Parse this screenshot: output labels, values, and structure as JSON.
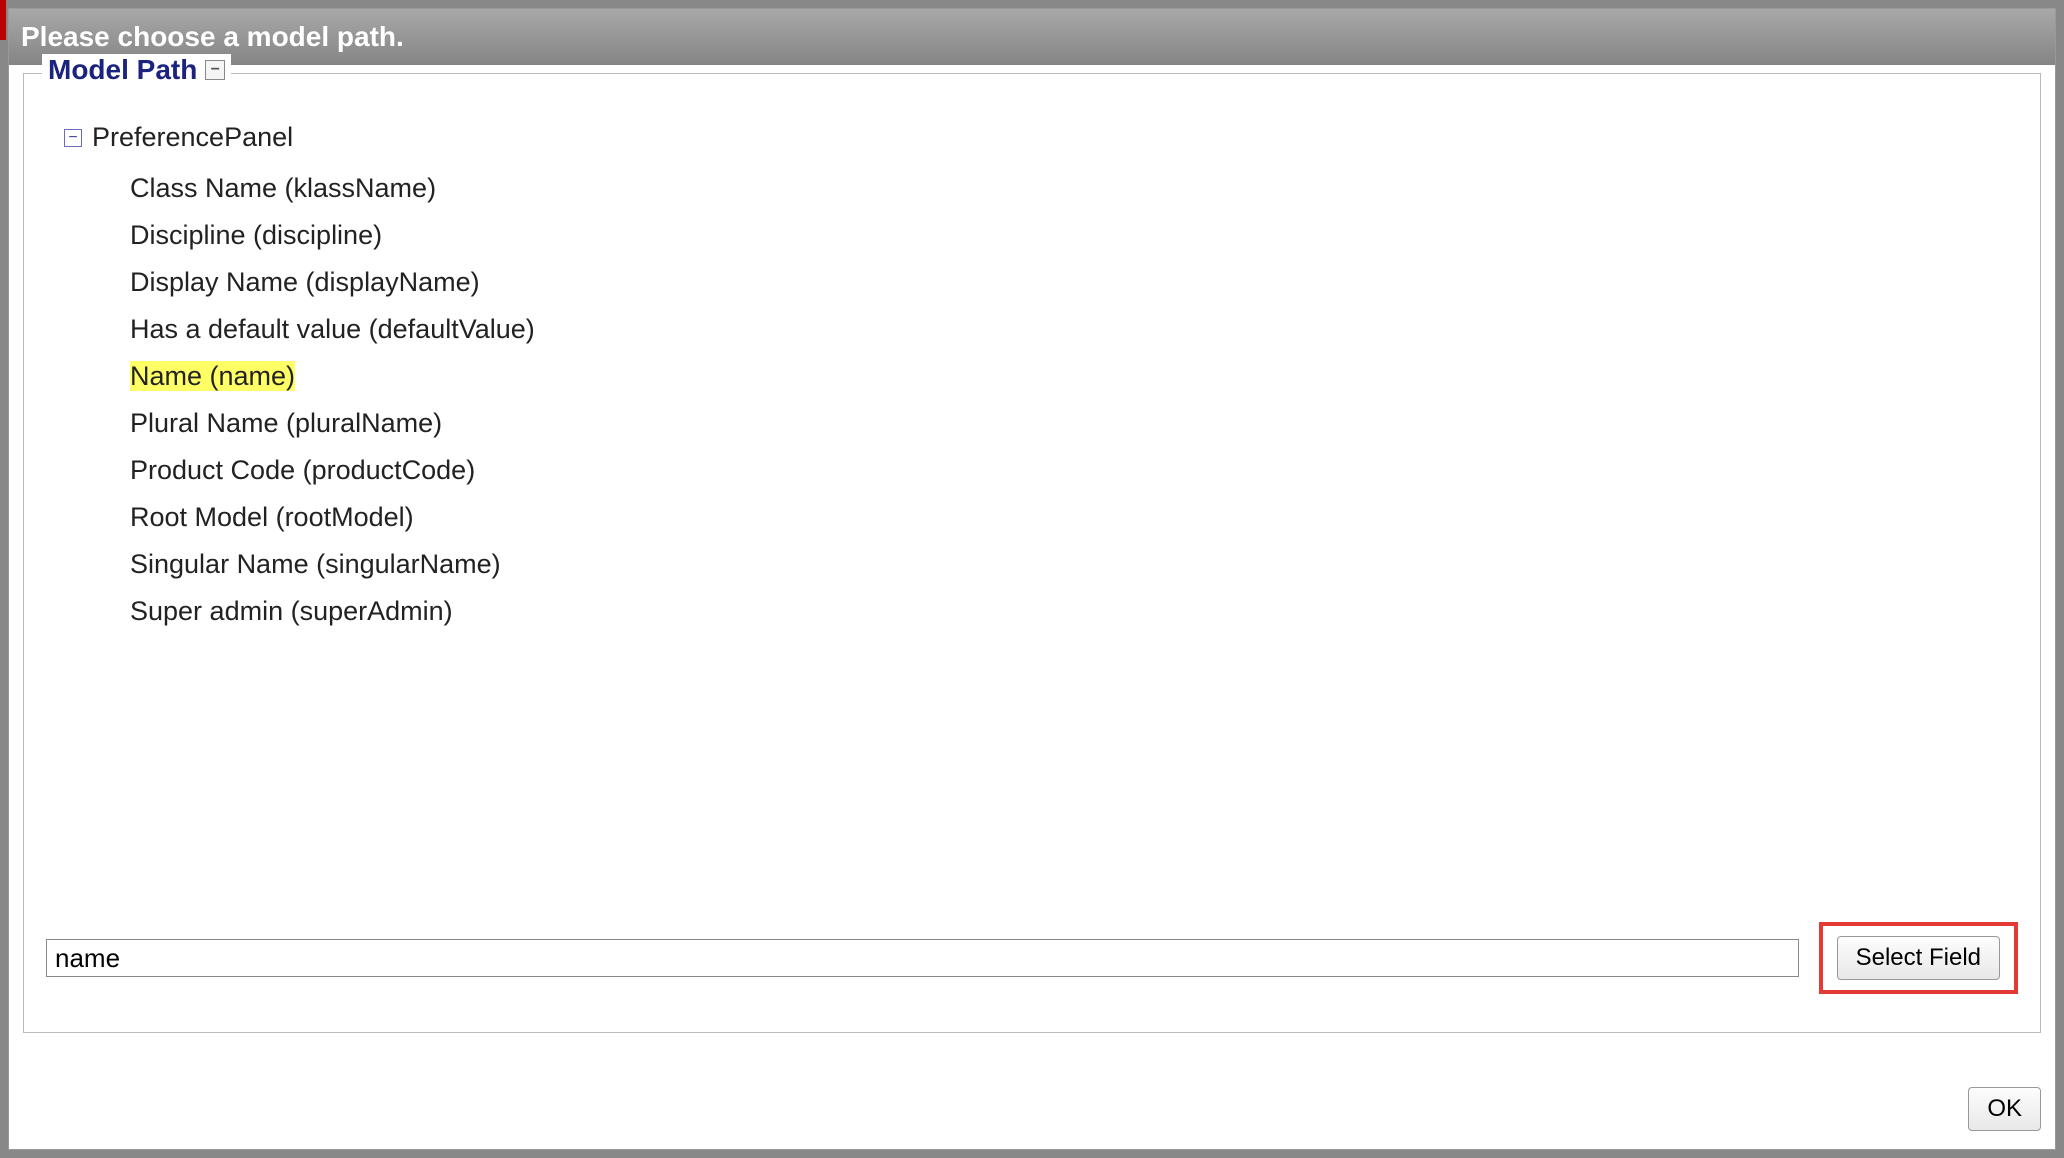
{
  "dialog": {
    "title": "Please choose a model path.",
    "fieldset_label": "Model Path"
  },
  "tree": {
    "root": "PreferencePanel",
    "items": [
      {
        "label": "Class Name (klassName)",
        "selected": false
      },
      {
        "label": "Discipline (discipline)",
        "selected": false
      },
      {
        "label": "Display Name (displayName)",
        "selected": false
      },
      {
        "label": "Has a default value (defaultValue)",
        "selected": false
      },
      {
        "label": "Name (name)",
        "selected": true
      },
      {
        "label": "Plural Name (pluralName)",
        "selected": false
      },
      {
        "label": "Product Code (productCode)",
        "selected": false
      },
      {
        "label": "Root Model (rootModel)",
        "selected": false
      },
      {
        "label": "Singular Name (singularName)",
        "selected": false
      },
      {
        "label": "Super admin (superAdmin)",
        "selected": false
      }
    ]
  },
  "input": {
    "value": "name"
  },
  "buttons": {
    "select_field": "Select Field",
    "ok": "OK"
  }
}
